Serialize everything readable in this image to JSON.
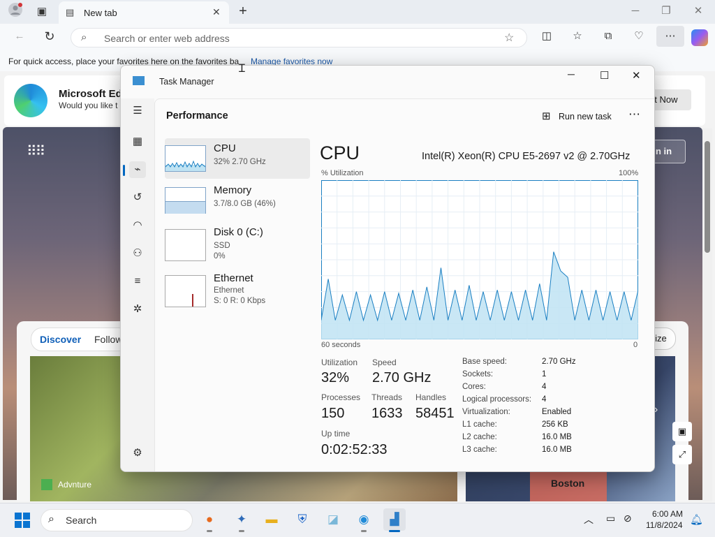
{
  "browser": {
    "tab_title": "New tab",
    "address_placeholder": "Search or enter web address",
    "favorites_prompt": "For quick access, place your favorites here on the favorites ba",
    "favorites_link": "Manage favorites now"
  },
  "edge_page": {
    "banner_title": "Microsoft Edg",
    "banner_sub": "Would you like t",
    "banner_button": "ot Now",
    "signin": "gn in",
    "feed_tabs": [
      "Discover",
      "Follow"
    ],
    "personalize": "lize",
    "card_source": "Advnture",
    "card_city": "Boston"
  },
  "taskmgr": {
    "title": "Task Manager",
    "section": "Performance",
    "run_new_task": "Run new task",
    "resources": [
      {
        "name": "CPU",
        "sub1": "32%  2.70 GHz",
        "sub2": ""
      },
      {
        "name": "Memory",
        "sub1": "3.7/8.0 GB (46%)",
        "sub2": ""
      },
      {
        "name": "Disk 0 (C:)",
        "sub1": "SSD",
        "sub2": "0%"
      },
      {
        "name": "Ethernet",
        "sub1": "Ethernet",
        "sub2": "S: 0  R: 0 Kbps"
      }
    ],
    "detail": {
      "heading": "CPU",
      "model": "Intel(R) Xeon(R) CPU E5-2697 v2 @ 2.70GHz",
      "util_label": "% Utilization",
      "util_max": "100%",
      "time_label": "60 seconds",
      "time_min": "0",
      "utilization_label": "Utilization",
      "utilization_value": "32%",
      "speed_label": "Speed",
      "speed_value": "2.70 GHz",
      "processes_label": "Processes",
      "processes_value": "150",
      "threads_label": "Threads",
      "threads_value": "1633",
      "handles_label": "Handles",
      "handles_value": "58451",
      "uptime_label": "Up time",
      "uptime_value": "0:02:52:33",
      "specs": [
        {
          "k": "Base speed:",
          "v": "2.70 GHz"
        },
        {
          "k": "Sockets:",
          "v": "1"
        },
        {
          "k": "Cores:",
          "v": "4"
        },
        {
          "k": "Logical processors:",
          "v": "4"
        },
        {
          "k": "Virtualization:",
          "v": "Enabled"
        },
        {
          "k": "L1 cache:",
          "v": "256 KB"
        },
        {
          "k": "L2 cache:",
          "v": "16.0 MB"
        },
        {
          "k": "L3 cache:",
          "v": "16.0 MB"
        }
      ]
    },
    "cpu_history": [
      12,
      38,
      12,
      28,
      12,
      30,
      12,
      28,
      12,
      30,
      12,
      29,
      12,
      31,
      12,
      33,
      12,
      45,
      12,
      31,
      12,
      34,
      12,
      30,
      12,
      31,
      12,
      30,
      12,
      31,
      12,
      35,
      12,
      55,
      43,
      39,
      12,
      31,
      12,
      31,
      12,
      30,
      12,
      30,
      12,
      31
    ],
    "memory_level": 0.46
  },
  "taskbar": {
    "search": "Search",
    "time": "6:00 AM",
    "date": "11/8/2024"
  },
  "colors": {
    "cpu_line": "#1a7fc2",
    "cpu_fill": "#bfe3f3",
    "accent": "#0067c0"
  }
}
